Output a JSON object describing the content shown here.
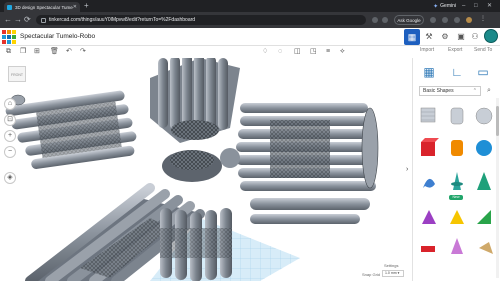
{
  "browser": {
    "tab_title": "3D design Spectacular Tumelo-",
    "tab_close": "✕",
    "new_tab": "+",
    "url": "tinkercad.com/things/auuY0lMpvw8/edit?returnTo=%2Fdashboard",
    "gemini_label": "Gemini",
    "ask_google": "Ask Google",
    "nav_back": "←",
    "nav_forward": "→",
    "nav_reload": "⟳",
    "win_min": "–",
    "win_max": "□",
    "win_close": "✕"
  },
  "app": {
    "design_title": "Spectacular Tumelo-Robo",
    "logo_colors": [
      "#e6332a",
      "#f29200",
      "#ffd400",
      "#1f9ad6",
      "#0f6fb5",
      "#3aa935",
      "#e6332a",
      "#1f9ad6",
      "#ffd400"
    ],
    "accent": "#1d5fbf"
  },
  "panel": {
    "labels": {
      "import": "Import",
      "export": "Export",
      "send_to": "Send To"
    },
    "library": "Basic Shapes",
    "new_badge": "New"
  },
  "viewport": {
    "viewcube_label": "FRONT",
    "settings_label": "Settings",
    "snap_grid_label": "Snap Grid",
    "snap_grid_value": "1.0 mm ▾"
  }
}
